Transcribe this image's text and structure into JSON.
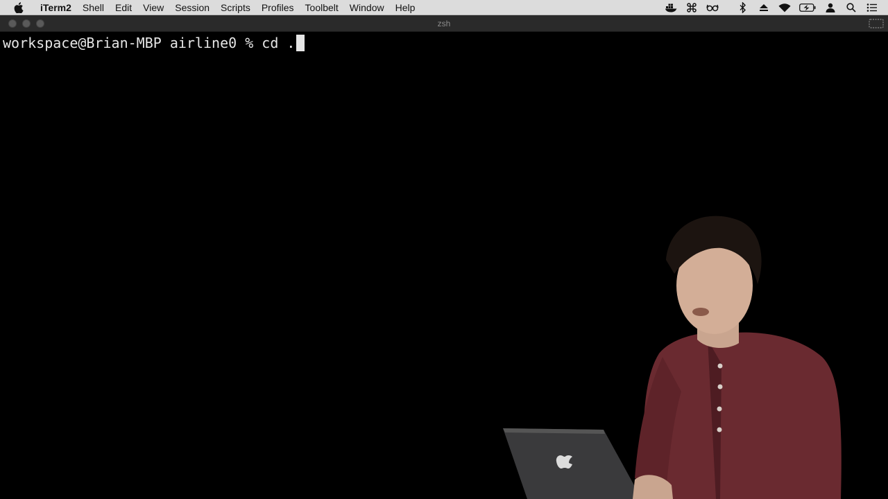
{
  "menubar": {
    "app_name": "iTerm2",
    "items": [
      "Shell",
      "Edit",
      "View",
      "Session",
      "Scripts",
      "Profiles",
      "Toolbelt",
      "Window",
      "Help"
    ],
    "status_icons": [
      "docker-icon",
      "command-icon",
      "glasses-icon",
      "bluetooth-icon",
      "eject-icon",
      "wifi-icon",
      "battery-icon",
      "user-icon",
      "spotlight-icon",
      "notification-center-icon"
    ]
  },
  "window": {
    "title": "zsh"
  },
  "terminal": {
    "prompt": "workspace@Brian-MBP airline0 % ",
    "command": "cd ."
  },
  "colors": {
    "menubar_bg": "#dcdcdc",
    "terminal_bg": "#000000",
    "terminal_fg": "#e6e6e6",
    "presenter_shirt": "#6a2a30"
  }
}
